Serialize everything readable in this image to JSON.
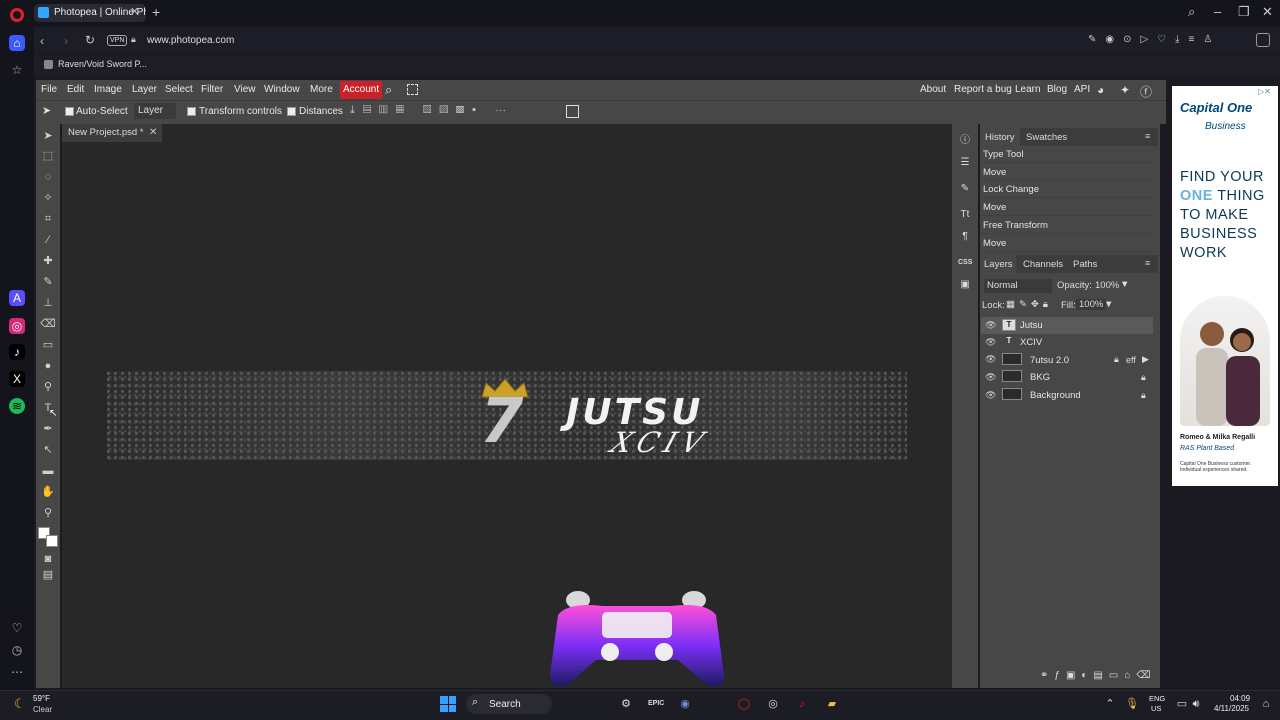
{
  "browser": {
    "tab_title": "Photopea | Online Photo E",
    "url": "www.photopea.com",
    "vpn": "VPN",
    "bookmark": "Raven/Void Sword P..."
  },
  "menu": [
    "File",
    "Edit",
    "Image",
    "Layer",
    "Select",
    "Filter",
    "View",
    "Window",
    "More"
  ],
  "account": "Account",
  "right_menu": [
    "About",
    "Report a bug",
    "Learn",
    "Blog",
    "API"
  ],
  "options": {
    "auto_select": "Auto-Select",
    "layer_select": "Layer",
    "transform_controls": "Transform controls",
    "distances": "Distances"
  },
  "document_tab": "New Project.psd *",
  "banner": {
    "seven": "7",
    "title": "JUTSU",
    "subtitle": "XCIV"
  },
  "history": {
    "tabs": [
      "History",
      "Swatches"
    ],
    "items": [
      "Type Tool",
      "Move",
      "Lock Change",
      "Move",
      "Free Transform",
      "Move"
    ]
  },
  "layers_panel": {
    "tabs": [
      "Layers",
      "Channels",
      "Paths"
    ],
    "blend_mode": "Normal",
    "opacity_label": "Opacity:",
    "opacity_value": "100%",
    "lock_label": "Lock:",
    "fill_label": "Fill:",
    "fill_value": "100%",
    "layers": [
      {
        "name": "Jutsu",
        "thumb": "T"
      },
      {
        "name": "XCIV",
        "thumb": "T"
      },
      {
        "name": "7utsu 2.0",
        "thumb": "",
        "fx": "eff"
      },
      {
        "name": "BKG",
        "thumb": ""
      },
      {
        "name": "Background",
        "thumb": ""
      }
    ]
  },
  "ad": {
    "brand": "Capital One",
    "brand_sub": "Business",
    "headline_1": "FIND YOUR",
    "headline_2_strong": "ONE",
    "headline_2_rest": " THING",
    "headline_3": "TO MAKE",
    "headline_4": "BUSINESS",
    "headline_5": "WORK",
    "names": "Romeo & Milka Regalli",
    "company": "RAS Plant Based",
    "disclaimer": "Capital One Business customer. Individual experiences shared."
  },
  "taskbar": {
    "weather_temp": "59°F",
    "weather_desc": "Clear",
    "search": "Search",
    "lang_1": "ENG",
    "lang_2": "US",
    "time": "04:09",
    "date": "4/11/2025"
  },
  "colors": {
    "accent_account": "#c8212a",
    "panel_bg": "#474747",
    "canvas_bg": "#282828"
  }
}
